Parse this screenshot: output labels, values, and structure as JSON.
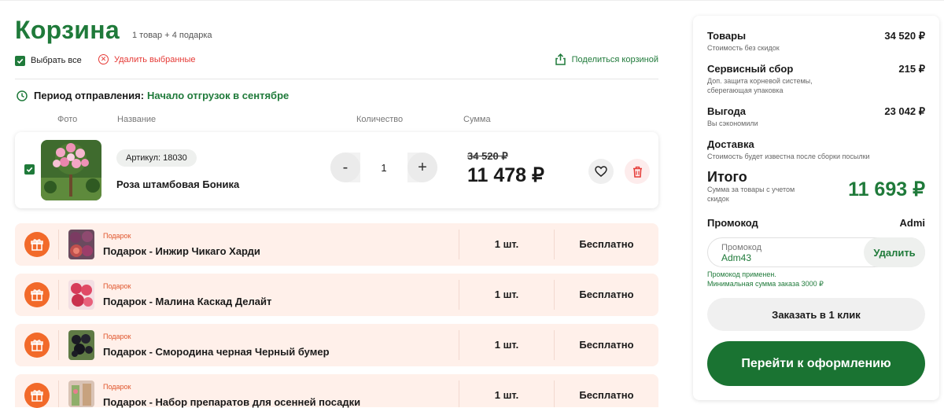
{
  "cart": {
    "title": "Корзина",
    "subtitle": "1 товар + 4 подарка",
    "select_all": "Выбрать все",
    "delete_selected": "Удалить выбранные",
    "share": "Поделиться корзиной",
    "period_label": "Период отправления:",
    "period_value": "Начало отгрузок в сентябре",
    "columns": {
      "photo": "Фото",
      "name": "Название",
      "quantity": "Количество",
      "sum": "Сумма"
    }
  },
  "product": {
    "sku": "Артикул: 18030",
    "name": "Роза штамбовая Боника",
    "qty": "1",
    "minus": "-",
    "plus": "+",
    "old_price": "34 520 ₽",
    "new_price": "11 478 ₽"
  },
  "gifts": [
    {
      "tag": "Подарок",
      "name": "Подарок - Инжир Чикаго Харди",
      "qty": "1 шт.",
      "price": "Бесплатно"
    },
    {
      "tag": "Подарок",
      "name": "Подарок - Малина Каскад Делайт",
      "qty": "1 шт.",
      "price": "Бесплатно"
    },
    {
      "tag": "Подарок",
      "name": "Подарок - Смородина черная Черный бумер",
      "qty": "1 шт.",
      "price": "Бесплатно"
    },
    {
      "tag": "Подарок",
      "name": "Подарок - Набор препаратов для осенней посадки",
      "qty": "1 шт.",
      "price": "Бесплатно"
    }
  ],
  "summary": {
    "goods_label": "Товары",
    "goods_sub": "Стоимость без скидок",
    "goods_value": "34 520 ₽",
    "service_label": "Сервисный сбор",
    "service_sub": "Доп. защита корневой системы, сберегающая упаковка",
    "service_value": "215 ₽",
    "benefit_label": "Выгода",
    "benefit_sub": "Вы сэкономили",
    "benefit_value": "23 042 ₽",
    "delivery_label": "Доставка",
    "delivery_sub": "Стоимость будет известна после сборки посылки",
    "total_label": "Итого",
    "total_sub": "Сумма за товары с учетом скидок",
    "total_value": "11 693 ₽",
    "promo_label": "Промокод",
    "promo_applied_name": "Admi",
    "promo_placeholder": "Промокод",
    "promo_value": "Adm43",
    "promo_remove": "Удалить",
    "promo_msg_1": "Промокод применен.",
    "promo_msg_2": "Минимальная сумма заказа 3000 ₽",
    "one_click": "Заказать в 1 клик",
    "checkout": "Перейти к оформлению"
  },
  "colors": {
    "brand_green": "#1f7a3a",
    "checkout_green": "#1a7332",
    "gift_bg": "#fff0ea",
    "gift_icon": "#f26a2a",
    "danger": "#e53935"
  },
  "icons": [
    "check-icon",
    "close-circle-icon",
    "share-icon",
    "clock-icon",
    "heart-icon",
    "trash-icon",
    "gift-icon"
  ]
}
